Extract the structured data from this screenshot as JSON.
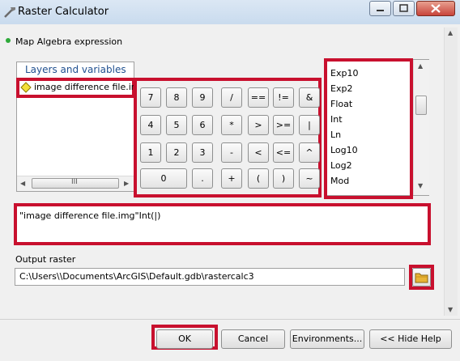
{
  "window": {
    "title": "Raster Calculator"
  },
  "section": {
    "map_algebra_label": "Map Algebra expression"
  },
  "layers": {
    "header": "Layers and variables",
    "items": [
      "image difference file.img"
    ],
    "hscroll_thumb": "III"
  },
  "keypad": [
    "7",
    "8",
    "9",
    "/",
    "==",
    "!=",
    "&",
    "4",
    "5",
    "6",
    "*",
    ">",
    ">=",
    "|",
    "1",
    "2",
    "3",
    "-",
    "<",
    "<=",
    "^",
    "0",
    ".",
    "+",
    "(",
    ")",
    "~"
  ],
  "functions": [
    "Exp10",
    "Exp2",
    "Float",
    "Int",
    "Ln",
    "Log10",
    "Log2",
    "Mod"
  ],
  "expression": {
    "value": "\"image difference file.img\"Int(|)"
  },
  "output": {
    "label": "Output raster",
    "value": "C:\\Users\\\\Documents\\ArcGIS\\Default.gdb\\rastercalc3"
  },
  "buttons": {
    "ok": "OK",
    "cancel": "Cancel",
    "environments": "Environments...",
    "hide_help": "<< Hide Help"
  },
  "colors": {
    "highlight_red": "#c8102e",
    "titlebar": "#c9dbee",
    "layer_icon": "#f3e03a"
  }
}
